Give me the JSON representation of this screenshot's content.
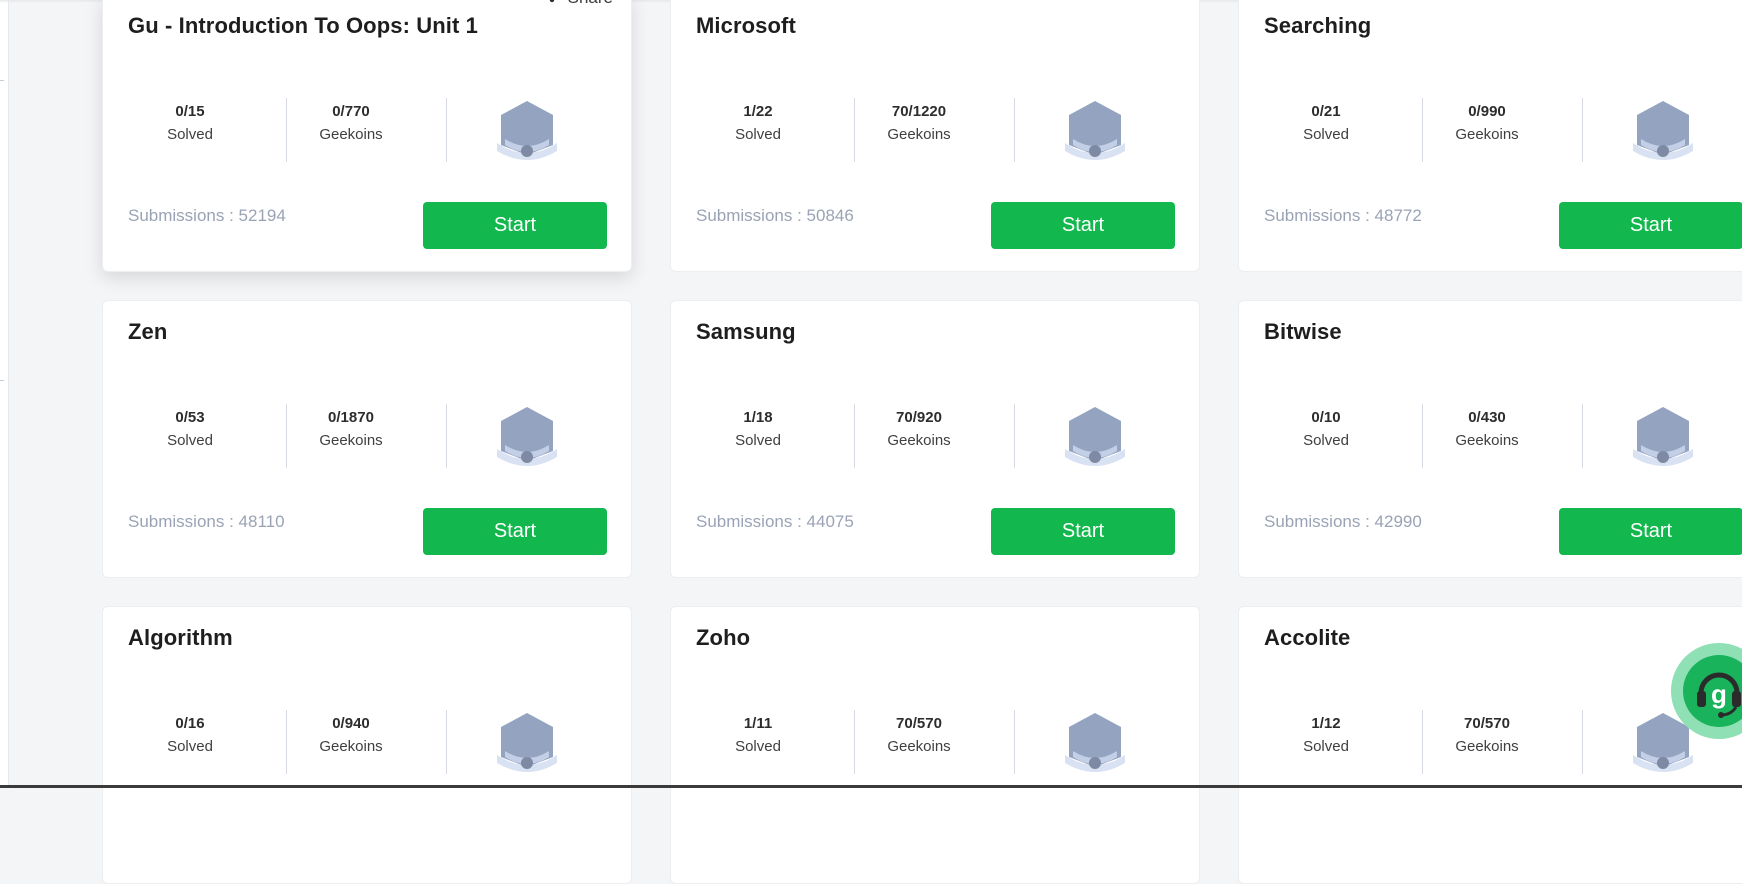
{
  "share_label": "Share",
  "stat_labels": {
    "solved": "Solved",
    "geekoins": "Geekoins"
  },
  "submissions_prefix": "Submissions : ",
  "start_label": "Start",
  "colors": {
    "start_button": "#12b84d",
    "badge": "#94a3bf",
    "badge_ribbon": "#d9e2f3",
    "submissions_text": "#9aa3b5"
  },
  "cards": [
    {
      "title": "Gu - Introduction To Oops: Unit 1",
      "solved": "0/15",
      "geekoins": "0/770",
      "submissions": "52194"
    },
    {
      "title": "Microsoft",
      "solved": "1/22",
      "geekoins": "70/1220",
      "submissions": "50846"
    },
    {
      "title": "Searching",
      "solved": "0/21",
      "geekoins": "0/990",
      "submissions": "48772"
    },
    {
      "title": "Zen",
      "solved": "0/53",
      "geekoins": "0/1870",
      "submissions": "48110"
    },
    {
      "title": "Samsung",
      "solved": "1/18",
      "geekoins": "70/920",
      "submissions": "44075"
    },
    {
      "title": "Bitwise",
      "solved": "0/10",
      "geekoins": "0/430",
      "submissions": "42990"
    },
    {
      "title": "Algorithm",
      "solved": "0/16",
      "geekoins": "0/940",
      "submissions": ""
    },
    {
      "title": "Zoho",
      "solved": "1/11",
      "geekoins": "70/570",
      "submissions": ""
    },
    {
      "title": "Accolite",
      "solved": "1/12",
      "geekoins": "70/570",
      "submissions": ""
    }
  ],
  "help_button_icon": "headset-support-icon"
}
